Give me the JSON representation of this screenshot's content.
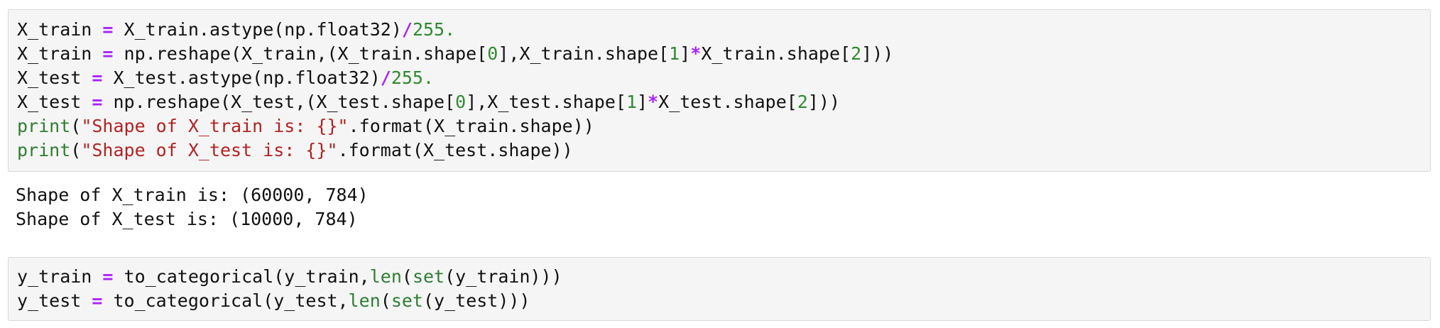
{
  "colors": {
    "operator": "#aa22ff",
    "number": "#2f8a2f",
    "builtin": "#2e7d32",
    "string": "#b22222",
    "text": "#111111",
    "cell_background": "#f5f5f5",
    "cell_border": "#d9d9d9"
  },
  "cells": [
    {
      "lines": [
        [
          {
            "t": "X_train ",
            "k": "plain"
          },
          {
            "t": "=",
            "k": "op"
          },
          {
            "t": " X_train.astype(np.float32)",
            "k": "plain"
          },
          {
            "t": "/",
            "k": "op"
          },
          {
            "t": "255.",
            "k": "num"
          }
        ],
        [
          {
            "t": "X_train ",
            "k": "plain"
          },
          {
            "t": "=",
            "k": "op"
          },
          {
            "t": " np.reshape(X_train,(X_train.shape[",
            "k": "plain"
          },
          {
            "t": "0",
            "k": "num"
          },
          {
            "t": "],X_train.shape[",
            "k": "plain"
          },
          {
            "t": "1",
            "k": "num"
          },
          {
            "t": "]",
            "k": "plain"
          },
          {
            "t": "*",
            "k": "op"
          },
          {
            "t": "X_train.shape[",
            "k": "plain"
          },
          {
            "t": "2",
            "k": "num"
          },
          {
            "t": "]))",
            "k": "plain"
          }
        ],
        [
          {
            "t": "X_test ",
            "k": "plain"
          },
          {
            "t": "=",
            "k": "op"
          },
          {
            "t": " X_test.astype(np.float32)",
            "k": "plain"
          },
          {
            "t": "/",
            "k": "op"
          },
          {
            "t": "255.",
            "k": "num"
          }
        ],
        [
          {
            "t": "X_test ",
            "k": "plain"
          },
          {
            "t": "=",
            "k": "op"
          },
          {
            "t": " np.reshape(X_test,(X_test.shape[",
            "k": "plain"
          },
          {
            "t": "0",
            "k": "num"
          },
          {
            "t": "],X_test.shape[",
            "k": "plain"
          },
          {
            "t": "1",
            "k": "num"
          },
          {
            "t": "]",
            "k": "plain"
          },
          {
            "t": "*",
            "k": "op"
          },
          {
            "t": "X_test.shape[",
            "k": "plain"
          },
          {
            "t": "2",
            "k": "num"
          },
          {
            "t": "]))",
            "k": "plain"
          }
        ],
        [
          {
            "t": "print",
            "k": "builtin"
          },
          {
            "t": "(",
            "k": "plain"
          },
          {
            "t": "\"Shape of X_train is: {}\"",
            "k": "str"
          },
          {
            "t": ".format(X_train.shape))",
            "k": "plain"
          }
        ],
        [
          {
            "t": "print",
            "k": "builtin"
          },
          {
            "t": "(",
            "k": "plain"
          },
          {
            "t": "\"Shape of X_test is: {}\"",
            "k": "str"
          },
          {
            "t": ".format(X_test.shape))",
            "k": "plain"
          }
        ]
      ]
    },
    {
      "lines": [
        [
          {
            "t": "y_train ",
            "k": "plain"
          },
          {
            "t": "=",
            "k": "op"
          },
          {
            "t": " to_categorical(y_train,",
            "k": "plain"
          },
          {
            "t": "len",
            "k": "builtin"
          },
          {
            "t": "(",
            "k": "plain"
          },
          {
            "t": "set",
            "k": "builtin"
          },
          {
            "t": "(y_train)))",
            "k": "plain"
          }
        ],
        [
          {
            "t": "y_test ",
            "k": "plain"
          },
          {
            "t": "=",
            "k": "op"
          },
          {
            "t": " to_categorical(y_test,",
            "k": "plain"
          },
          {
            "t": "len",
            "k": "builtin"
          },
          {
            "t": "(",
            "k": "plain"
          },
          {
            "t": "set",
            "k": "builtin"
          },
          {
            "t": "(y_test)))",
            "k": "plain"
          }
        ]
      ]
    }
  ],
  "output": {
    "lines": [
      "Shape of X_train is: (60000, 784)",
      "Shape of X_test is: (10000, 784)"
    ]
  }
}
